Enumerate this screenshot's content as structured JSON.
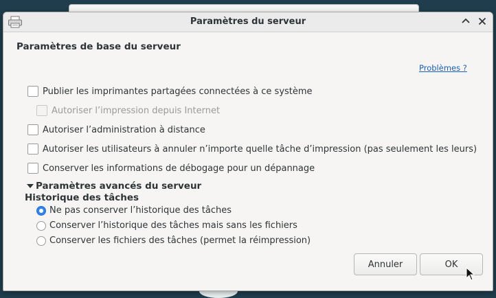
{
  "dialog": {
    "title": "Paramètres du serveur",
    "section_title": "Paramètres de base du serveur",
    "help_link": "Problèmes ?",
    "checkboxes": [
      {
        "label": "Publier les imprimantes partagées connectées à ce système",
        "checked": false,
        "enabled": true
      },
      {
        "label": "Autoriser l’impression depuis Internet",
        "checked": false,
        "enabled": false
      },
      {
        "label": "Autoriser l’administration à distance",
        "checked": false,
        "enabled": true
      },
      {
        "label": "Autoriser les utilisateurs à annuler n’importe quelle tâche d’impression (pas seulement les leurs)",
        "checked": false,
        "enabled": true
      },
      {
        "label": "Conserver les informations de débogage pour un dépannage",
        "checked": false,
        "enabled": true
      }
    ],
    "advanced_label": "Paramètres avancés du serveur",
    "history_title": "Historique des tâches",
    "radios": [
      {
        "label": "Ne pas conserver l’historique des tâches",
        "checked": true
      },
      {
        "label": "Conserver l’historique des tâches mais sans les fichiers",
        "checked": false
      },
      {
        "label": "Conserver les fichiers des tâches (permet la réimpression)",
        "checked": false
      }
    ],
    "cancel_label": "Annuler",
    "ok_label": "OK"
  },
  "colors": {
    "accent": "#3584e4",
    "link": "#1a5fb4",
    "desktop": "#1f3d4c"
  }
}
